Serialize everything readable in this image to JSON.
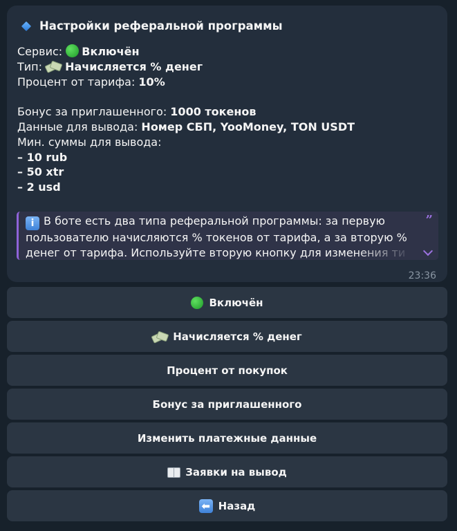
{
  "message": {
    "title": "Настройки реферальной программы",
    "service_label": "Сервис: ",
    "service_value": "Включён",
    "type_label": "Тип: ",
    "type_value": "Начисляется % денег",
    "percent_label": "Процент от тарифа: ",
    "percent_value": "10%",
    "bonus_label": "Бонус за приглашенного: ",
    "bonus_value": "1000 токенов",
    "payout_label": "Данные для вывода: ",
    "payout_value": "Номер СБП, YooMoney, TON USDT",
    "min_label": "Мин. суммы для вывода:",
    "min_amounts": [
      "– 10 rub",
      "– 50 xtr",
      "– 2 usd"
    ],
    "quote_text": "В боте есть два типа реферальной программы: за первую пользователю начисляются % токенов от тарифа, а за вторую % денег от тарифа. Используйте вторую кнопку для изменения ти",
    "time": "23:36"
  },
  "buttons": {
    "service": "Включён",
    "type": "Начисляется % денег",
    "percent": "Процент от покупок",
    "bonus": "Бонус за приглашенного",
    "payment": "Изменить платежные данные",
    "withdrawals": "Заявки на вывод",
    "back": "Назад"
  },
  "icons": {
    "title": "blue-diamond-icon",
    "service": "green-circle-icon",
    "type": "money-wings-icon",
    "info": "info-icon",
    "withdrawals": "open-book-icon",
    "back": "left-arrow-icon"
  },
  "colors": {
    "background": "#17212b",
    "bubble": "#232e3c",
    "button": "#2b3643",
    "quote_accent": "#8f63d9",
    "time": "#8a96a3"
  }
}
